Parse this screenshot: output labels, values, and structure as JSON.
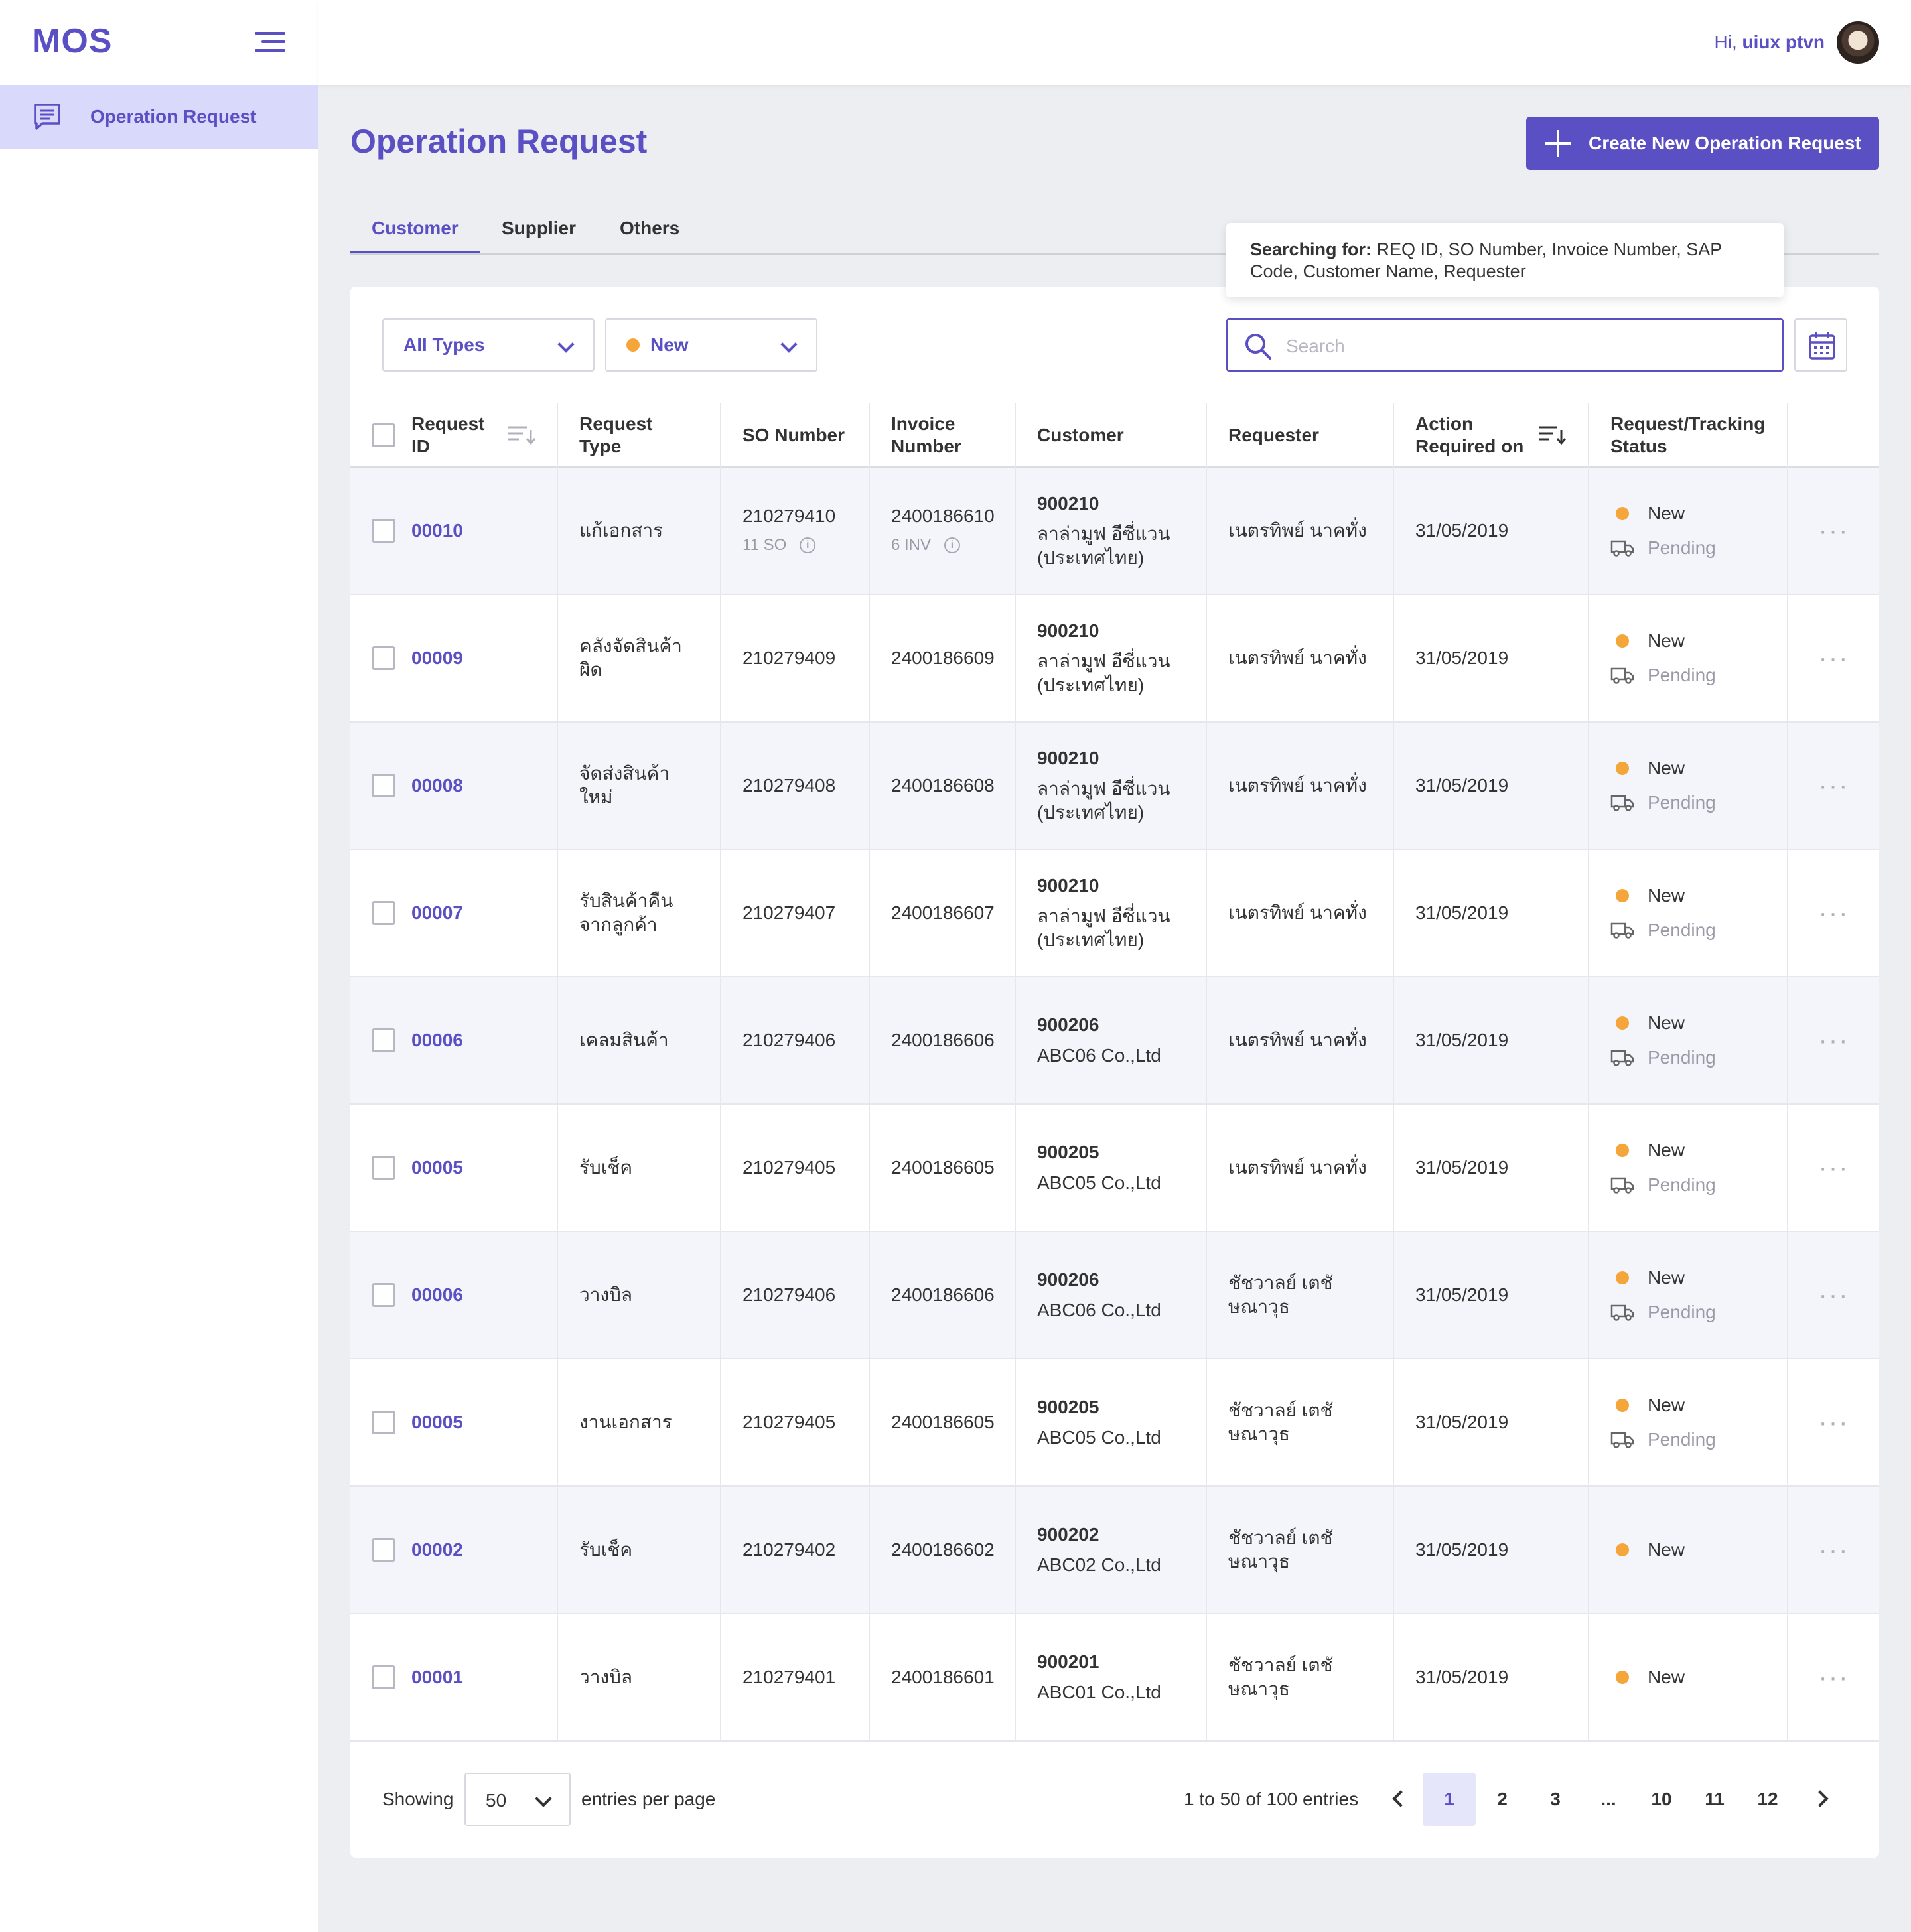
{
  "app": {
    "logo": "MOS"
  },
  "sidebar": {
    "items": [
      {
        "label": "Operation Request",
        "icon": "message-list-icon"
      }
    ]
  },
  "topbar": {
    "greeting": "Hi,",
    "username": "uiux ptvn"
  },
  "page": {
    "title": "Operation Request",
    "create_label": "Create New Operation Request"
  },
  "tabs": [
    {
      "label": "Customer",
      "active": true
    },
    {
      "label": "Supplier"
    },
    {
      "label": "Others"
    }
  ],
  "tooltip": {
    "title": "Searching for:",
    "text": "REQ ID, SO Number, Invoice Number, SAP Code, Customer Name, Requester"
  },
  "filters": {
    "type": "All Types",
    "status": "New"
  },
  "search": {
    "placeholder": "Search"
  },
  "table": {
    "headers": [
      "Request ID",
      "Request Type",
      "SO Number",
      "Invoice Number",
      "Customer",
      "Requester",
      "Action Required on",
      "Request/Tracking Status"
    ],
    "rows": [
      {
        "id": "00010",
        "type": "แก้เอกสาร",
        "so": "210279410",
        "so_sub": "11 SO",
        "inv": "2400186610",
        "inv_sub": "6 INV",
        "cust_code": "900210",
        "cust_name": "ลาล่ามูฟ อีซี่แวน (ประเทศไทย)",
        "requester": "เนตรทิพย์ นาคทั่ง",
        "date": "31/05/2019",
        "status": "New",
        "tracking": "Pending"
      },
      {
        "id": "00009",
        "type": "คลังจัดสินค้าผิด",
        "so": "210279409",
        "inv": "2400186609",
        "cust_code": "900210",
        "cust_name": "ลาล่ามูฟ อีซี่แวน (ประเทศไทย)",
        "requester": "เนตรทิพย์ นาคทั่ง",
        "date": "31/05/2019",
        "status": "New",
        "tracking": "Pending"
      },
      {
        "id": "00008",
        "type": "จัดส่งสินค้าใหม่",
        "so": "210279408",
        "inv": "2400186608",
        "cust_code": "900210",
        "cust_name": "ลาล่ามูฟ อีซี่แวน (ประเทศไทย)",
        "requester": "เนตรทิพย์ นาคทั่ง",
        "date": "31/05/2019",
        "status": "New",
        "tracking": "Pending"
      },
      {
        "id": "00007",
        "type": "รับสินค้าคืนจากลูกค้า",
        "so": "210279407",
        "inv": "2400186607",
        "cust_code": "900210",
        "cust_name": "ลาล่ามูฟ อีซี่แวน (ประเทศไทย)",
        "requester": "เนตรทิพย์ นาคทั่ง",
        "date": "31/05/2019",
        "status": "New",
        "tracking": "Pending"
      },
      {
        "id": "00006",
        "type": "เคลมสินค้า",
        "so": "210279406",
        "inv": "2400186606",
        "cust_code": "900206",
        "cust_name": "ABC06 Co.,Ltd",
        "requester": "เนตรทิพย์ นาคทั่ง",
        "date": "31/05/2019",
        "status": "New",
        "tracking": "Pending"
      },
      {
        "id": "00005",
        "type": "รับเช็ค",
        "so": "210279405",
        "inv": "2400186605",
        "cust_code": "900205",
        "cust_name": "ABC05 Co.,Ltd",
        "requester": "เนตรทิพย์ นาคทั่ง",
        "date": "31/05/2019",
        "status": "New",
        "tracking": "Pending"
      },
      {
        "id": "00006",
        "type": "วางบิล",
        "so": "210279406",
        "inv": "2400186606",
        "cust_code": "900206",
        "cust_name": "ABC06 Co.,Ltd",
        "requester": "ชัชวาลย์ เตชัษณาวุธ",
        "date": "31/05/2019",
        "status": "New",
        "tracking": "Pending"
      },
      {
        "id": "00005",
        "type": "งานเอกสาร",
        "so": "210279405",
        "inv": "2400186605",
        "cust_code": "900205",
        "cust_name": "ABC05 Co.,Ltd",
        "requester": "ชัชวาลย์ เตชัษณาวุธ",
        "date": "31/05/2019",
        "status": "New",
        "tracking": "Pending"
      },
      {
        "id": "00002",
        "type": "รับเช็ค",
        "so": "210279402",
        "inv": "2400186602",
        "cust_code": "900202",
        "cust_name": "ABC02 Co.,Ltd",
        "requester": "ชัชวาลย์ เตชัษณาวุธ",
        "date": "31/05/2019",
        "status": "New"
      },
      {
        "id": "00001",
        "type": "วางบิล",
        "so": "210279401",
        "inv": "2400186601",
        "cust_code": "900201",
        "cust_name": "ABC01 Co.,Ltd",
        "requester": "ชัชวาลย์ เตชัษณาวุธ",
        "date": "31/05/2019",
        "status": "New"
      }
    ]
  },
  "footer": {
    "showing": "Showing",
    "per_page": "50",
    "per_page_label": "entries per page",
    "entries": "1 to 50 of 100 entries",
    "pages": [
      "1",
      "2",
      "3",
      "...",
      "10",
      "11",
      "12"
    ]
  },
  "colors": {
    "accent": "#5b4fc4",
    "status_new": "#f5a63a",
    "row_shade": "#f3f5fb"
  }
}
